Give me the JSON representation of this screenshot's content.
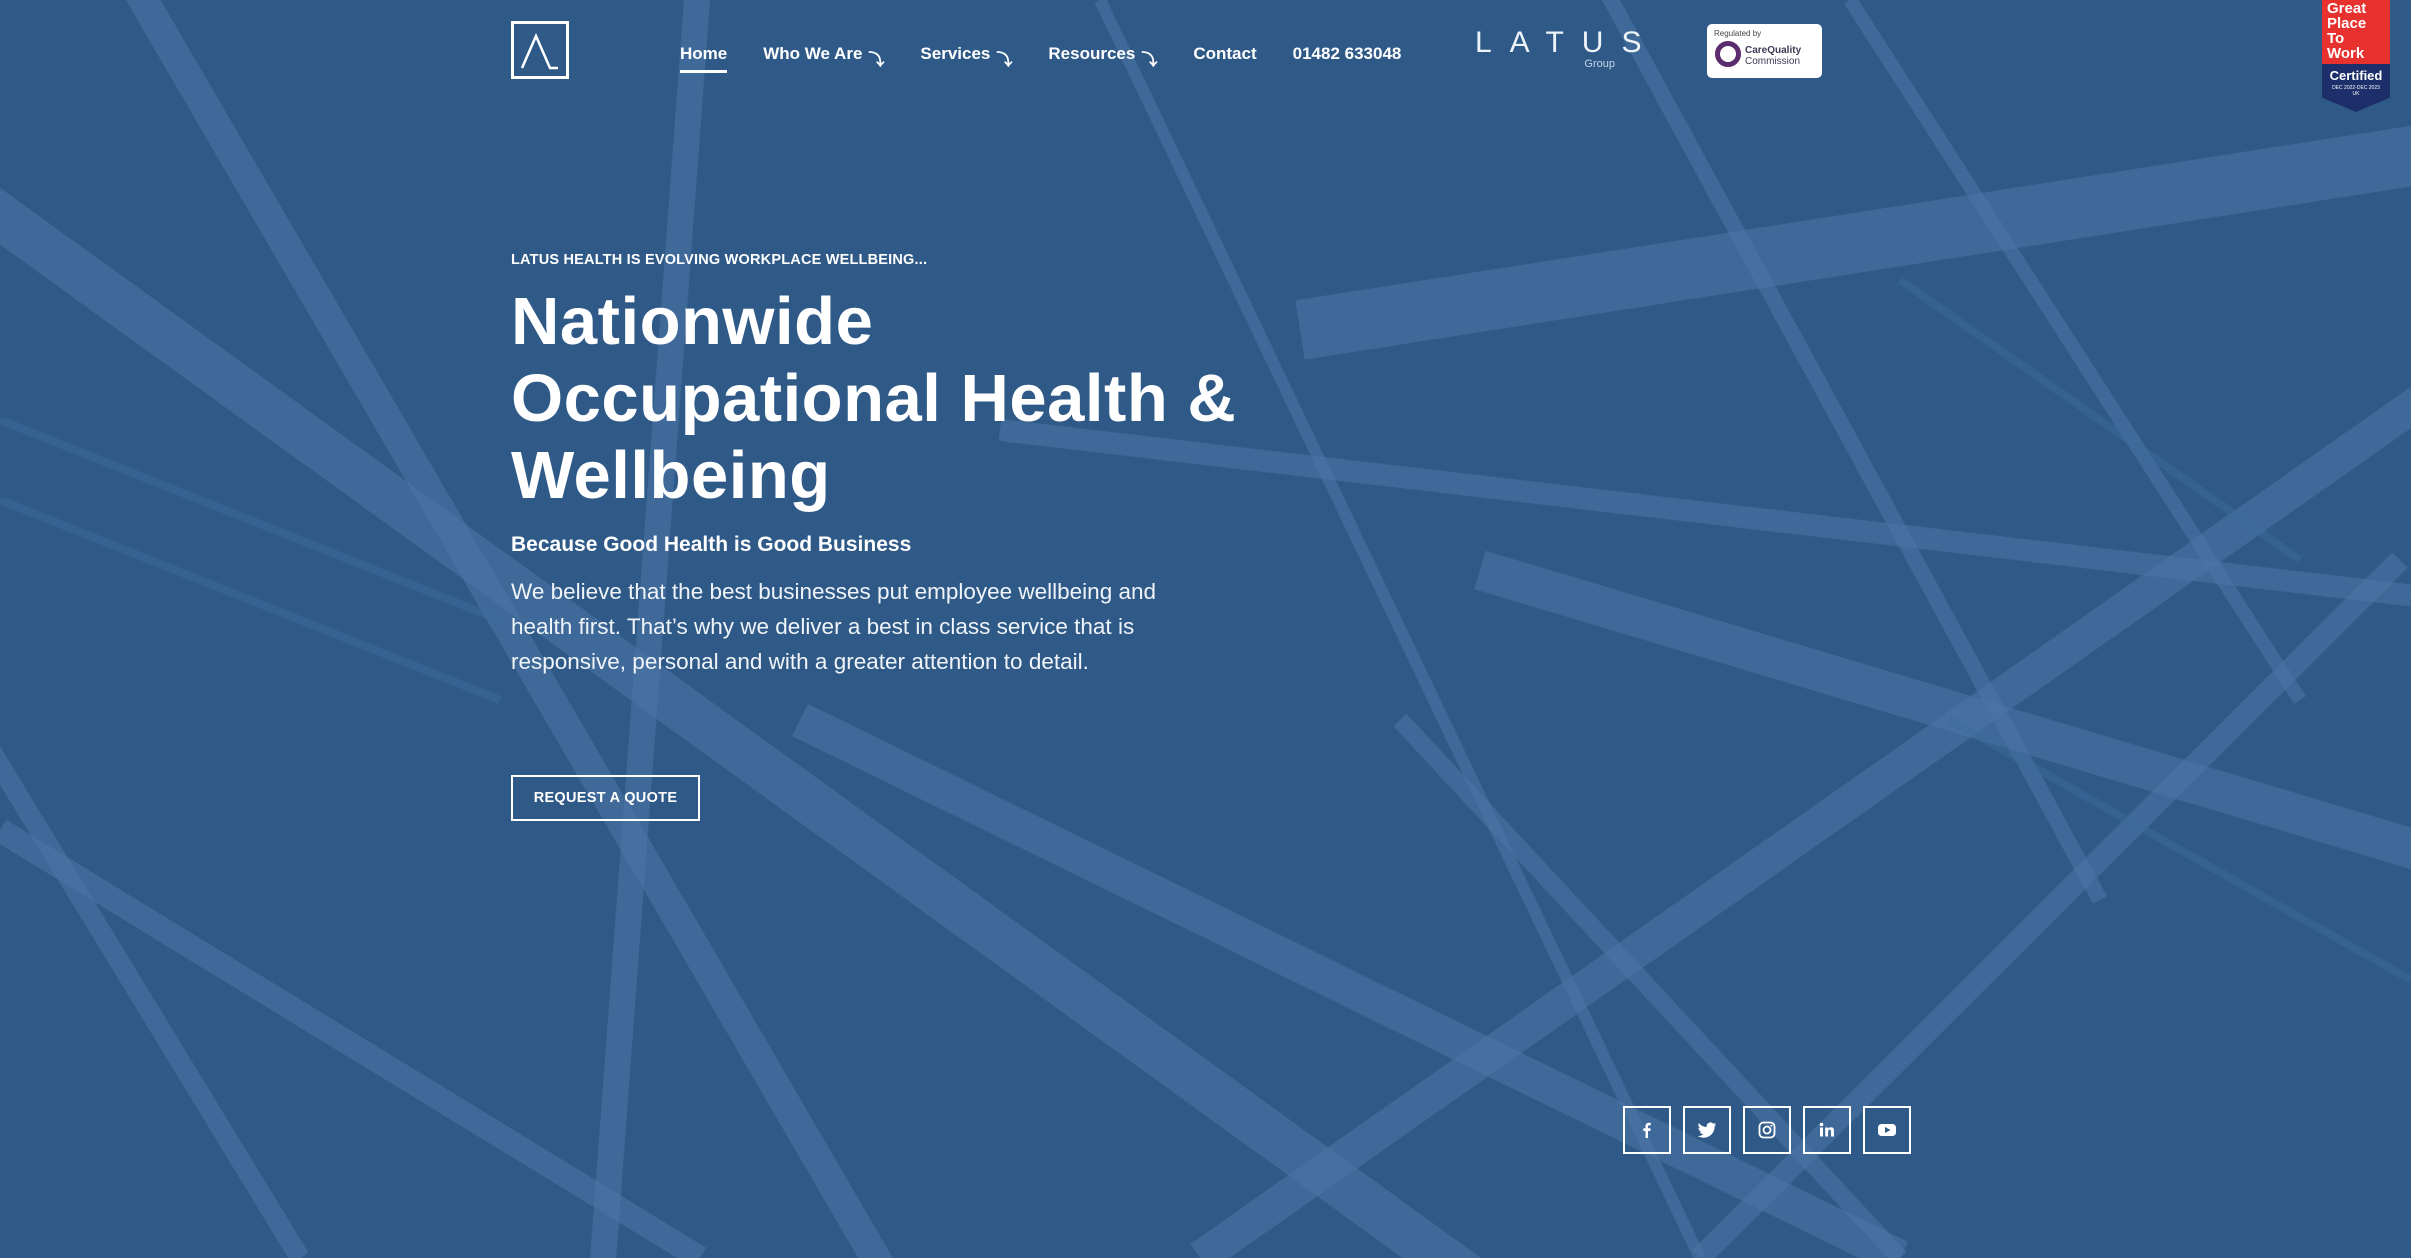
{
  "header": {
    "logo_icon": "latus-a-logo-icon",
    "nav": [
      {
        "label": "Home",
        "active": true,
        "has_dropdown": false
      },
      {
        "label": "Who We Are",
        "active": false,
        "has_dropdown": true
      },
      {
        "label": "Services",
        "active": false,
        "has_dropdown": true
      },
      {
        "label": "Resources",
        "active": false,
        "has_dropdown": true
      },
      {
        "label": "Contact",
        "active": false,
        "has_dropdown": false
      }
    ],
    "phone": "01482 633048",
    "dropdown_glyph": "⤵",
    "group_logo": {
      "word": "LATUS",
      "sub": "Group"
    },
    "cqc_badge": {
      "top": "Regulated by",
      "name_line1": "CareQuality",
      "name_line2": "Commission"
    },
    "gptw_badge": {
      "lines": [
        "Great",
        "Place",
        "To",
        "Work"
      ],
      "certified": "Certified",
      "date": "DEC 2022-DEC 2023",
      "country": "UK"
    }
  },
  "hero": {
    "eyebrow": "LATUS HEALTH IS EVOLVING WORKPLACE WELLBEING...",
    "headline": "Nationwide Occupational Health & Wellbeing",
    "subheading": "Because Good Health is Good Business",
    "body": "We believe that the best businesses put employee wellbeing and health first. That’s why we deliver a best in class service that is responsive, personal and with a greater attention to detail.",
    "cta_label": "REQUEST A QUOTE"
  },
  "social": [
    {
      "icon": "facebook-icon"
    },
    {
      "icon": "twitter-icon"
    },
    {
      "icon": "instagram-icon"
    },
    {
      "icon": "linkedin-icon"
    },
    {
      "icon": "youtube-icon"
    }
  ],
  "colors": {
    "overlay": "#2f5a88",
    "text": "#ffffff",
    "cqc_purple": "#5b2d6e",
    "gptw_red": "#e6312e",
    "gptw_navy": "#1d2f6a"
  }
}
